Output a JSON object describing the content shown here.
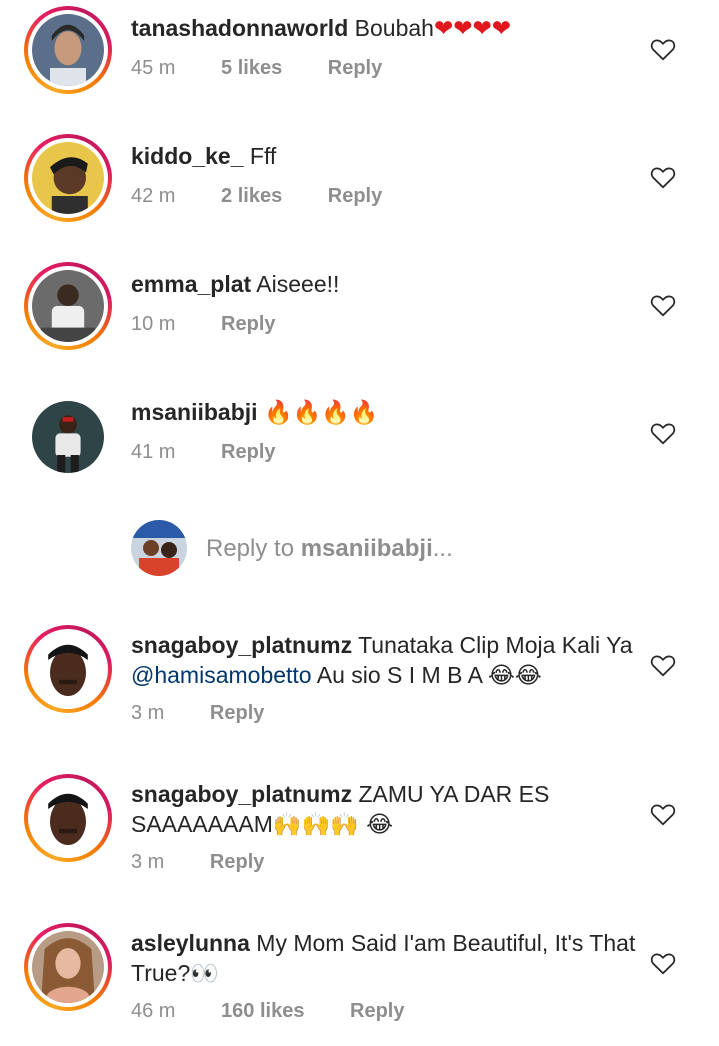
{
  "comments": [
    {
      "username": "tanashadonnaworld",
      "text": "Boubah",
      "emoji": "❤❤❤❤",
      "time": "45 m",
      "likes": "5 likes",
      "reply": "Reply"
    },
    {
      "username": "kiddo_ke_",
      "text": "Fff",
      "time": "42 m",
      "likes": "2 likes",
      "reply": "Reply"
    },
    {
      "username": "emma_plat",
      "text": "Aiseee!!",
      "time": "10 m",
      "reply": "Reply"
    },
    {
      "username": "msaniibabji",
      "emoji": "🔥🔥🔥🔥",
      "time": "41 m",
      "reply": "Reply"
    },
    {
      "username": "snagaboy_platnumz",
      "text_before": "Tunataka Clip Moja Kali Ya ",
      "mention": "@hamisamobetto",
      "text_after": " Au sio S I M B A ",
      "emoji": "😂😂",
      "time": "3 m",
      "reply": "Reply"
    },
    {
      "username": "snagaboy_platnumz",
      "text": "ZAMU YA DAR ES SAAAAAAAM",
      "emoji": "🙌🙌🙌 😂",
      "time": "3 m",
      "reply": "Reply"
    },
    {
      "username": "asleylunna",
      "text": "My Mom Said I'am Beautiful, It's That True?",
      "emoji": "👀",
      "time": "46 m",
      "likes": "160 likes",
      "reply": "Reply"
    }
  ],
  "reply_box": {
    "prefix": "Reply to ",
    "target": "msaniibabji",
    "suffix": "..."
  },
  "icons": {
    "like": "heart-outline-icon"
  },
  "colors": {
    "mention": "#00376b",
    "meta": "#8e8e8e",
    "text": "#262626"
  }
}
